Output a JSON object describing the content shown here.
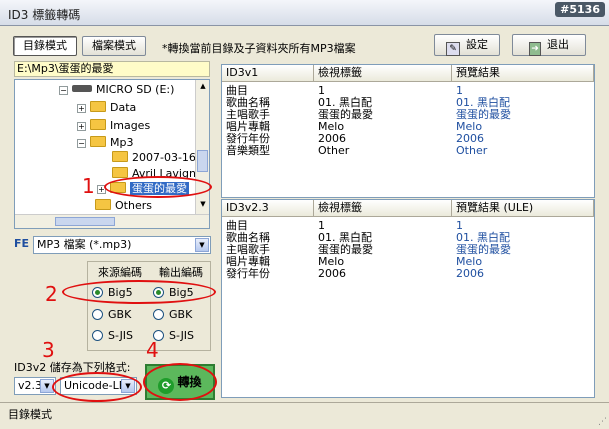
{
  "window": {
    "title": "ID3 標籤轉碼",
    "watermark": "#5136"
  },
  "toolbar": {
    "tab_folder": "目錄模式",
    "tab_file": "檔案模式",
    "note": "*轉換當前目錄及子資料夾所有MP3檔案",
    "settings_label": "設定",
    "exit_label": "退出"
  },
  "path": {
    "value": "E:\\Mp3\\蛋蛋的最愛"
  },
  "tree": {
    "drive": "MICRO SD (E:)",
    "items": [
      "Data",
      "Images",
      "Mp3",
      "2007-03-16 [",
      "Avril Lavigne",
      "蛋蛋的最愛",
      "Others"
    ]
  },
  "filetype": {
    "badge": "FE",
    "value": "MP3 檔案 (*.mp3)"
  },
  "encoding": {
    "source_title": "來源編碼",
    "output_title": "輸出編碼",
    "options": [
      "Big5",
      "GBK",
      "S-JIS"
    ]
  },
  "save": {
    "label": "ID3v2 儲存為下列格式:",
    "version": "v2.3",
    "format": "Unicode-LE",
    "convert_label": "轉換"
  },
  "v1": {
    "headers": [
      "ID3v1",
      "檢視標籤",
      "預覽結果"
    ],
    "rows": [
      [
        "曲目",
        "1",
        "1"
      ],
      [
        "歌曲名稱",
        "01. 黑白配",
        "01. 黑白配"
      ],
      [
        "主唱歌手",
        "蛋蛋的最愛",
        "蛋蛋的最愛"
      ],
      [
        "唱片專輯",
        "Melo",
        "Melo"
      ],
      [
        "發行年份",
        "2006",
        "2006"
      ],
      [
        "音樂類型",
        "Other",
        "Other"
      ]
    ]
  },
  "v2": {
    "headers": [
      "ID3v2.3",
      "檢視標籤",
      "預覽結果 (ULE)"
    ],
    "rows": [
      [
        "曲目",
        "1",
        "1"
      ],
      [
        "歌曲名稱",
        "01. 黑白配",
        "01. 黑白配"
      ],
      [
        "主唱歌手",
        "蛋蛋的最愛",
        "蛋蛋的最愛"
      ],
      [
        "唱片專輯",
        "Melo",
        "Melo"
      ],
      [
        "發行年份",
        "2006",
        "2006"
      ]
    ]
  },
  "status": {
    "text": "目錄模式"
  },
  "annotations": {
    "n1": "1",
    "n2": "2",
    "n3": "3",
    "n4": "4"
  },
  "colors": {
    "annotation": "#e01010",
    "link_blue": "#1f4fa0",
    "selection": "#316ac5"
  }
}
